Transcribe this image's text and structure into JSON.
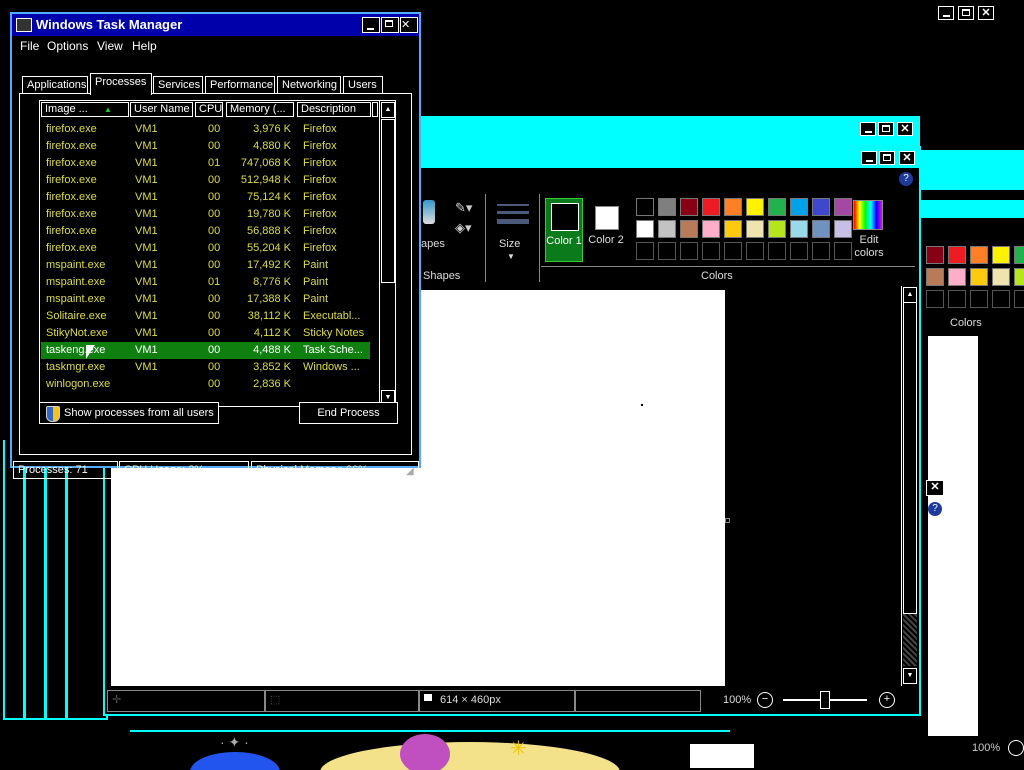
{
  "task_manager": {
    "title": "Windows Task Manager",
    "menu": [
      "File",
      "Options",
      "View",
      "Help"
    ],
    "tabs": [
      "Applications",
      "Processes",
      "Services",
      "Performance",
      "Networking",
      "Users"
    ],
    "active_tab": "Processes",
    "columns": [
      "Image ...",
      "User Name",
      "CPU",
      "Memory (...",
      "Description"
    ],
    "rows": [
      {
        "image": "firefox.exe",
        "user": "VM1",
        "cpu": "00",
        "mem": "3,976 K",
        "desc": "Firefox"
      },
      {
        "image": "firefox.exe",
        "user": "VM1",
        "cpu": "00",
        "mem": "4,880 K",
        "desc": "Firefox"
      },
      {
        "image": "firefox.exe",
        "user": "VM1",
        "cpu": "01",
        "mem": "747,068 K",
        "desc": "Firefox"
      },
      {
        "image": "firefox.exe",
        "user": "VM1",
        "cpu": "00",
        "mem": "512,948 K",
        "desc": "Firefox"
      },
      {
        "image": "firefox.exe",
        "user": "VM1",
        "cpu": "00",
        "mem": "75,124 K",
        "desc": "Firefox"
      },
      {
        "image": "firefox.exe",
        "user": "VM1",
        "cpu": "00",
        "mem": "19,780 K",
        "desc": "Firefox"
      },
      {
        "image": "firefox.exe",
        "user": "VM1",
        "cpu": "00",
        "mem": "56,888 K",
        "desc": "Firefox"
      },
      {
        "image": "firefox.exe",
        "user": "VM1",
        "cpu": "00",
        "mem": "55,204 K",
        "desc": "Firefox"
      },
      {
        "image": "mspaint.exe",
        "user": "VM1",
        "cpu": "00",
        "mem": "17,492 K",
        "desc": "Paint"
      },
      {
        "image": "mspaint.exe",
        "user": "VM1",
        "cpu": "01",
        "mem": "8,776 K",
        "desc": "Paint"
      },
      {
        "image": "mspaint.exe",
        "user": "VM1",
        "cpu": "00",
        "mem": "17,388 K",
        "desc": "Paint"
      },
      {
        "image": "Solitaire.exe",
        "user": "VM1",
        "cpu": "00",
        "mem": "38,112 K",
        "desc": "Executabl..."
      },
      {
        "image": "StikyNot.exe",
        "user": "VM1",
        "cpu": "00",
        "mem": "4,112 K",
        "desc": "Sticky Notes"
      },
      {
        "image": "taskeng.exe",
        "user": "VM1",
        "cpu": "00",
        "mem": "4,488 K",
        "desc": "Task Sche..."
      },
      {
        "image": "taskmgr.exe",
        "user": "VM1",
        "cpu": "00",
        "mem": "3,852 K",
        "desc": "Windows ..."
      },
      {
        "image": "winlogon.exe",
        "user": "",
        "cpu": "00",
        "mem": "2,836 K",
        "desc": ""
      }
    ],
    "selected_row": "taskeng.exe",
    "show_all_label": "Show processes from all users",
    "end_process_label": "End Process",
    "status": {
      "processes": "Processes: 71",
      "cpu": "CPU Usage: 2%",
      "memory": "Physical Memory: 66%"
    }
  },
  "paint": {
    "ribbon": {
      "shapes_partial": "apes",
      "shapes_group": "Shapes",
      "size_label": "Size",
      "color1_label": "Color 1",
      "color2_label": "Color 2",
      "colors_group": "Colors",
      "edit_colors_label": "Edit colors"
    },
    "palette_row1": [
      "#000000",
      "#7f7f7f",
      "#880015",
      "#ed1c24",
      "#ff7f27",
      "#fff200",
      "#22b14c",
      "#00a2e8",
      "#3f48cc",
      "#a349a4"
    ],
    "palette_row2": [
      "#ffffff",
      "#c3c3c3",
      "#b97a57",
      "#ffaec9",
      "#ffc90e",
      "#efe4b0",
      "#b5e61d",
      "#99d9ea",
      "#7092be",
      "#c8bfe7"
    ],
    "status": {
      "canvas_size": "614 × 460px",
      "zoom": "100%"
    }
  },
  "background_window": {
    "colors_label": "Colors",
    "zoom": "100%",
    "palette_row1": [
      "#880015",
      "#ed1c24",
      "#ff7f27",
      "#fff200",
      "#22b14c"
    ],
    "palette_row2": [
      "#b97a57",
      "#ffaec9",
      "#ffc90e",
      "#efe4b0",
      "#b5e61d"
    ]
  }
}
